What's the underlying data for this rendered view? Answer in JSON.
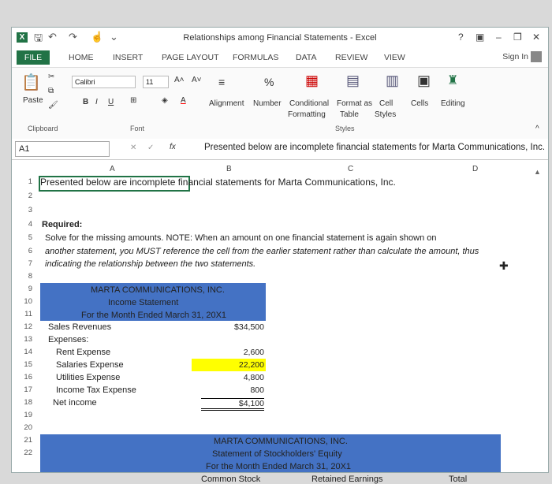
{
  "window": {
    "title": "Relationships among Financial Statements - Excel",
    "controls": [
      "?",
      "▣",
      "–",
      "❐",
      "✕"
    ]
  },
  "tabs": [
    "FILE",
    "HOME",
    "INSERT",
    "PAGE LAYOUT",
    "FORMULAS",
    "DATA",
    "REVIEW",
    "VIEW"
  ],
  "sign_in": "Sign In",
  "ribbon": {
    "paste": "Paste",
    "clipboard": "Clipboard",
    "font_name": "Calibri",
    "font_size": "11",
    "font_group": "Font",
    "bold": "B",
    "italic": "I",
    "underline": "U",
    "alignment": "Alignment",
    "number": "Number",
    "percent": "%",
    "conditional": "Conditional",
    "formatting": "Formatting",
    "format_as": "Format as",
    "table": "Table",
    "cell": "Cell",
    "styles_btn": "Styles",
    "styles_group": "Styles",
    "cells": "Cells",
    "editing": "Editing"
  },
  "formula_bar": {
    "name_box": "A1",
    "fx": "fx",
    "content": "Presented below are incomplete financial statements for Marta Communications, Inc."
  },
  "columns": [
    "A",
    "B",
    "C",
    "D"
  ],
  "rows": [
    "1",
    "2",
    "3",
    "4",
    "5",
    "6",
    "7",
    "8",
    "9",
    "10",
    "11",
    "12",
    "13",
    "14",
    "15",
    "16",
    "17",
    "18",
    "19",
    "20",
    "21",
    "22"
  ],
  "sheet": {
    "r1": "Presented below are incomplete financial statements for Marta Communications, Inc.",
    "r3": "Required:",
    "r4": "Solve for the missing amounts. NOTE: When an amount on one financial statement is again shown on",
    "r5": "another statement, you MUST reference the cell from the earlier statement rather than calculate the amount, thus",
    "r6": "indicating the relationship between the two statements.",
    "income": {
      "company": "MARTA COMMUNICATIONS, INC.",
      "title": "Income Statement",
      "period": "For the Month Ended March 31, 20X1",
      "sales_label": "Sales Revenues",
      "sales": "$34,500",
      "expenses": "Expenses:",
      "rent_label": "Rent Expense",
      "rent": "2,600",
      "salaries_label": "Salaries Expense",
      "salaries": "22,200",
      "utilities_label": "Utilities Expense",
      "utilities": "4,800",
      "tax_label": "Income Tax Expense",
      "tax": "800",
      "net_label": "Net income",
      "net": "$4,100"
    },
    "equity": {
      "company": "MARTA COMMUNICATIONS, INC.",
      "title": "Statement of Stockholders' Equity",
      "period": "For the Month Ended March 31, 20X1",
      "col1": "Common Stock",
      "col2": "Retained Earnings",
      "col3": "Total"
    }
  },
  "colors": {
    "excel_green": "#217346",
    "header_blue": "#4472c4",
    "highlight": "#ffff00"
  }
}
